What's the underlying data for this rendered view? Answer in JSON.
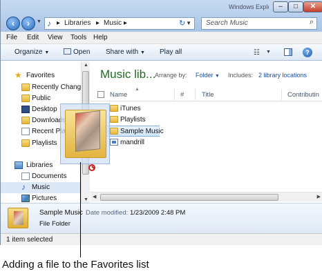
{
  "window": {
    "title": "Windows Explorer"
  },
  "address": {
    "segments": [
      "Libraries",
      "Music"
    ],
    "separator": "▸"
  },
  "search": {
    "placeholder": "Search Music"
  },
  "menu": [
    "File",
    "Edit",
    "View",
    "Tools",
    "Help"
  ],
  "toolbar": {
    "organize": "Organize",
    "open": "Open",
    "share_with": "Share with",
    "play_all": "Play all"
  },
  "nav": {
    "favorites_header": "Favorites",
    "favorites": [
      "Recently Change",
      "Public",
      "Desktop",
      "Downloads",
      "Recent Places",
      "Playlists"
    ],
    "libraries_header": "Libraries",
    "libraries": [
      "Documents",
      "Music",
      "Pictures"
    ]
  },
  "content": {
    "title": "Music lib...",
    "arrange_label": "Arrange by:",
    "arrange_value": "Folder",
    "includes_label": "Includes:",
    "includes_link": "2 library locations",
    "columns": [
      "Name",
      "#",
      "Title",
      "Contributin"
    ],
    "rows": [
      {
        "name": "iTunes",
        "type": "folder",
        "selected": false
      },
      {
        "name": "Playlists",
        "type": "folder",
        "selected": false
      },
      {
        "name": "Sample Music",
        "type": "folder",
        "selected": true
      },
      {
        "name": "mandrill",
        "type": "file",
        "selected": false
      }
    ]
  },
  "details": {
    "name": "Sample Music",
    "modified_label": "Date modified:",
    "modified_value": "1/23/2009 2:48 PM",
    "type": "File Folder"
  },
  "status": {
    "text": "1 item selected"
  },
  "caption": "Adding a file to the Favorites list"
}
